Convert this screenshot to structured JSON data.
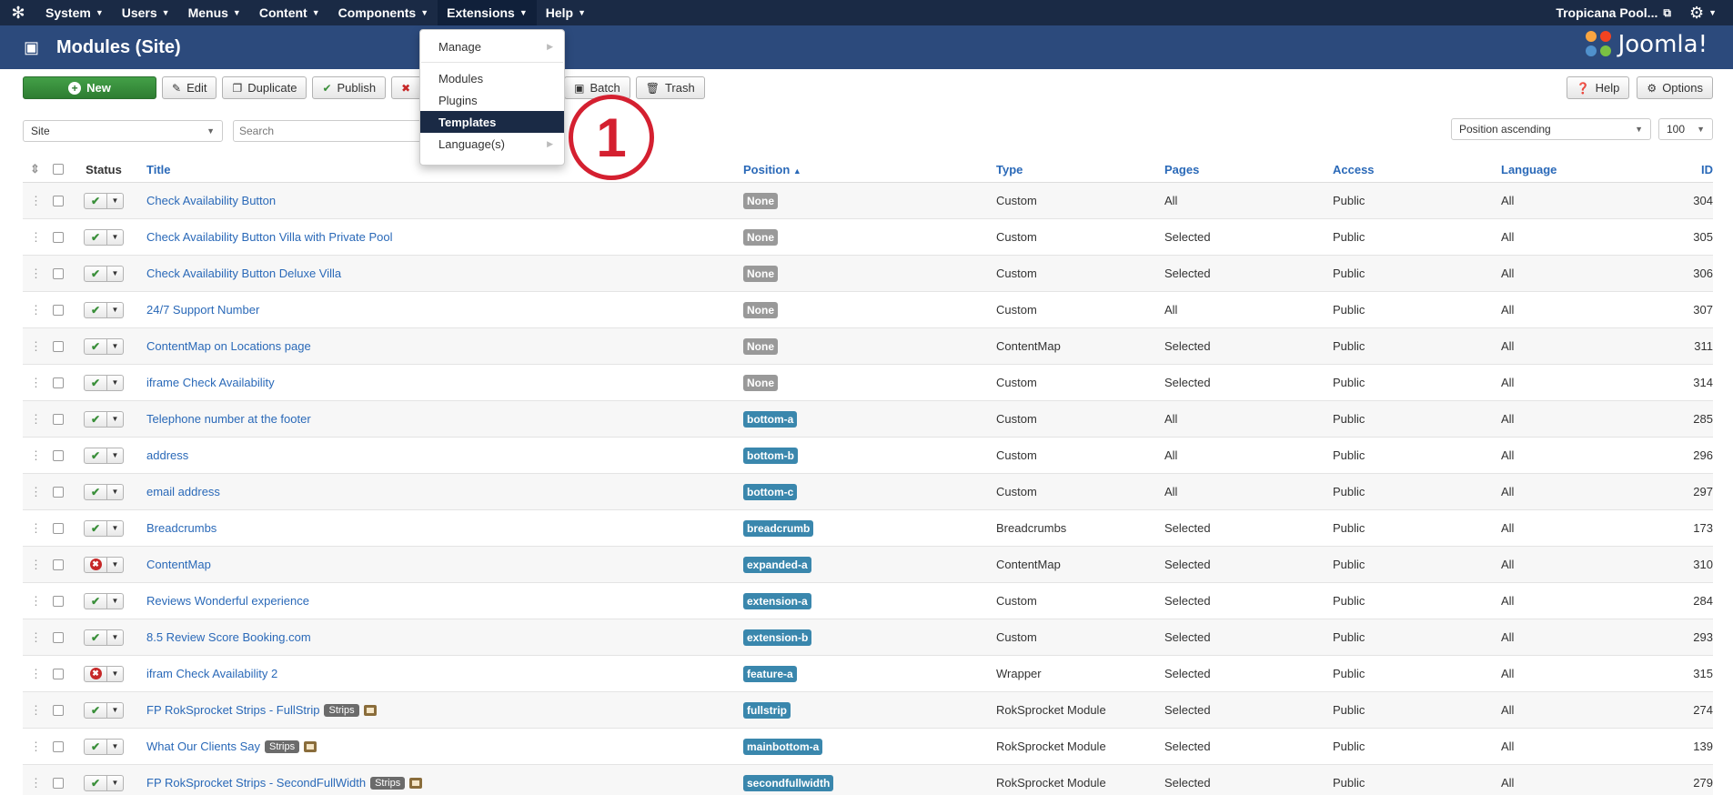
{
  "nav": {
    "items": [
      "System",
      "Users",
      "Menus",
      "Content",
      "Components",
      "Extensions",
      "Help"
    ],
    "site_name": "Tropicana Pool..."
  },
  "header": {
    "title": "Modules (Site)",
    "brand": "Joomla!"
  },
  "toolbar": {
    "new": "New",
    "edit": "Edit",
    "duplicate": "Duplicate",
    "publish": "Publish",
    "batch": "Batch",
    "trash": "Trash",
    "help": "Help",
    "options": "Options"
  },
  "filters": {
    "client": "Site",
    "search_placeholder": "Search",
    "ordering": "Position ascending",
    "limit": "100"
  },
  "columns": {
    "status": "Status",
    "title": "Title",
    "position": "Position",
    "position_arrow": "▲",
    "type": "Type",
    "pages": "Pages",
    "access": "Access",
    "language": "Language",
    "id": "ID"
  },
  "ext_menu": {
    "manage": "Manage",
    "modules": "Modules",
    "plugins": "Plugins",
    "templates": "Templates",
    "languages": "Language(s)"
  },
  "callout": "1",
  "rows": [
    {
      "published": true,
      "title": "Check Availability Button",
      "position": "None",
      "type": "Custom",
      "pages": "All",
      "access": "Public",
      "language": "All",
      "id": "304"
    },
    {
      "published": true,
      "title": "Check Availability Button Villa with Private Pool",
      "position": "None",
      "type": "Custom",
      "pages": "Selected",
      "access": "Public",
      "language": "All",
      "id": "305"
    },
    {
      "published": true,
      "title": "Check Availability Button Deluxe Villa",
      "position": "None",
      "type": "Custom",
      "pages": "Selected",
      "access": "Public",
      "language": "All",
      "id": "306"
    },
    {
      "published": true,
      "title": "24/7 Support Number",
      "position": "None",
      "type": "Custom",
      "pages": "All",
      "access": "Public",
      "language": "All",
      "id": "307"
    },
    {
      "published": true,
      "title": "ContentMap on Locations page",
      "position": "None",
      "type": "ContentMap",
      "pages": "Selected",
      "access": "Public",
      "language": "All",
      "id": "311"
    },
    {
      "published": true,
      "title": "iframe Check Availability",
      "position": "None",
      "type": "Custom",
      "pages": "Selected",
      "access": "Public",
      "language": "All",
      "id": "314"
    },
    {
      "published": true,
      "title": "Telephone number at the footer",
      "position": "bottom-a",
      "type": "Custom",
      "pages": "All",
      "access": "Public",
      "language": "All",
      "id": "285"
    },
    {
      "published": true,
      "title": "address",
      "position": "bottom-b",
      "type": "Custom",
      "pages": "All",
      "access": "Public",
      "language": "All",
      "id": "296"
    },
    {
      "published": true,
      "title": "email address",
      "position": "bottom-c",
      "type": "Custom",
      "pages": "All",
      "access": "Public",
      "language": "All",
      "id": "297"
    },
    {
      "published": true,
      "title": "Breadcrumbs",
      "position": "breadcrumb",
      "type": "Breadcrumbs",
      "pages": "Selected",
      "access": "Public",
      "language": "All",
      "id": "173"
    },
    {
      "published": false,
      "title": "ContentMap",
      "position": "expanded-a",
      "type": "ContentMap",
      "pages": "Selected",
      "access": "Public",
      "language": "All",
      "id": "310"
    },
    {
      "published": true,
      "title": "Reviews Wonderful experience",
      "position": "extension-a",
      "type": "Custom",
      "pages": "Selected",
      "access": "Public",
      "language": "All",
      "id": "284"
    },
    {
      "published": true,
      "title": "8.5 Review Score Booking.com",
      "position": "extension-b",
      "type": "Custom",
      "pages": "Selected",
      "access": "Public",
      "language": "All",
      "id": "293"
    },
    {
      "published": false,
      "title": "ifram Check Availability 2",
      "position": "feature-a",
      "type": "Wrapper",
      "pages": "Selected",
      "access": "Public",
      "language": "All",
      "id": "315"
    },
    {
      "published": true,
      "title": "FP RokSprocket Strips - FullStrip",
      "badge": "Strips",
      "position": "fullstrip",
      "type": "RokSprocket Module",
      "pages": "Selected",
      "access": "Public",
      "language": "All",
      "id": "274"
    },
    {
      "published": true,
      "title": "What Our Clients Say",
      "badge": "Strips",
      "position": "mainbottom-a",
      "type": "RokSprocket Module",
      "pages": "Selected",
      "access": "Public",
      "language": "All",
      "id": "139"
    },
    {
      "published": true,
      "title": "FP RokSprocket Strips - SecondFullWidth",
      "badge": "Strips",
      "position": "secondfullwidth",
      "type": "RokSprocket Module",
      "pages": "Selected",
      "access": "Public",
      "language": "All",
      "id": "279"
    }
  ]
}
